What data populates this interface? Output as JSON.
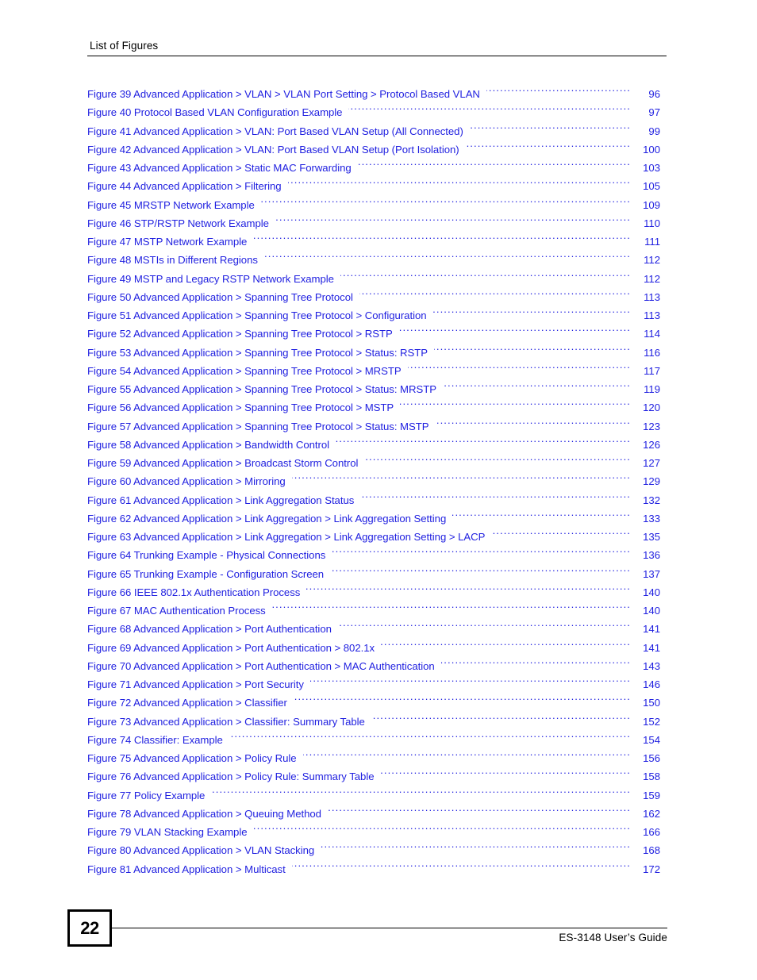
{
  "header": {
    "title": "List of Figures"
  },
  "figure_list": {
    "entries": [
      {
        "label": "Figure 39 Advanced Application > VLAN > VLAN Port Setting > Protocol Based VLAN",
        "page": "96"
      },
      {
        "label": "Figure 40 Protocol Based VLAN Configuration Example",
        "page": "97"
      },
      {
        "label": "Figure 41 Advanced Application > VLAN: Port Based VLAN Setup (All Connected)",
        "page": "99"
      },
      {
        "label": "Figure 42 Advanced Application > VLAN: Port Based VLAN Setup (Port Isolation)",
        "page": "100"
      },
      {
        "label": "Figure 43 Advanced Application > Static MAC Forwarding",
        "page": "103"
      },
      {
        "label": "Figure 44 Advanced Application > Filtering",
        "page": "105"
      },
      {
        "label": "Figure 45 MRSTP Network Example",
        "page": "109"
      },
      {
        "label": "Figure 46 STP/RSTP Network Example",
        "page": "110"
      },
      {
        "label": "Figure 47 MSTP Network Example",
        "page": "111"
      },
      {
        "label": "Figure 48 MSTIs in Different Regions",
        "page": "112"
      },
      {
        "label": "Figure 49 MSTP and Legacy RSTP Network Example",
        "page": "112"
      },
      {
        "label": "Figure 50 Advanced Application > Spanning Tree Protocol",
        "page": "113"
      },
      {
        "label": "Figure 51 Advanced Application > Spanning Tree Protocol > Configuration",
        "page": "113"
      },
      {
        "label": "Figure 52 Advanced Application > Spanning Tree Protocol > RSTP",
        "page": "114"
      },
      {
        "label": "Figure 53 Advanced Application > Spanning Tree Protocol > Status: RSTP",
        "page": "116"
      },
      {
        "label": "Figure 54 Advanced Application > Spanning Tree Protocol > MRSTP",
        "page": "117"
      },
      {
        "label": "Figure 55 Advanced Application > Spanning Tree Protocol > Status: MRSTP",
        "page": "119"
      },
      {
        "label": "Figure 56 Advanced Application > Spanning Tree Protocol > MSTP",
        "page": "120"
      },
      {
        "label": "Figure 57 Advanced Application > Spanning Tree Protocol > Status: MSTP",
        "page": "123"
      },
      {
        "label": "Figure 58 Advanced Application > Bandwidth Control",
        "page": "126"
      },
      {
        "label": "Figure 59 Advanced Application > Broadcast Storm Control",
        "page": "127"
      },
      {
        "label": "Figure 60 Advanced Application > Mirroring",
        "page": "129"
      },
      {
        "label": "Figure 61 Advanced Application > Link Aggregation Status",
        "page": "132"
      },
      {
        "label": "Figure 62 Advanced Application > Link Aggregation > Link Aggregation Setting",
        "page": "133"
      },
      {
        "label": "Figure 63 Advanced Application > Link Aggregation > Link Aggregation Setting > LACP",
        "page": "135"
      },
      {
        "label": "Figure 64 Trunking Example - Physical Connections",
        "page": "136"
      },
      {
        "label": "Figure 65 Trunking Example - Configuration Screen",
        "page": "137"
      },
      {
        "label": "Figure 66 IEEE 802.1x Authentication Process",
        "page": "140"
      },
      {
        "label": "Figure 67 MAC Authentication Process",
        "page": "140"
      },
      {
        "label": "Figure 68 Advanced Application > Port Authentication",
        "page": "141"
      },
      {
        "label": "Figure 69 Advanced Application > Port Authentication > 802.1x",
        "page": "141"
      },
      {
        "label": "Figure 70 Advanced Application > Port Authentication > MAC Authentication",
        "page": "143"
      },
      {
        "label": "Figure 71 Advanced Application > Port Security",
        "page": "146"
      },
      {
        "label": "Figure 72 Advanced Application > Classifier",
        "page": "150"
      },
      {
        "label": "Figure 73 Advanced Application > Classifier: Summary Table",
        "page": "152"
      },
      {
        "label": "Figure 74 Classifier: Example",
        "page": "154"
      },
      {
        "label": "Figure 75 Advanced Application > Policy Rule",
        "page": "156"
      },
      {
        "label": "Figure 76 Advanced Application > Policy Rule: Summary Table",
        "page": "158"
      },
      {
        "label": "Figure 77 Policy Example",
        "page": "159"
      },
      {
        "label": "Figure 78 Advanced Application > Queuing Method",
        "page": "162"
      },
      {
        "label": "Figure 79 VLAN Stacking Example",
        "page": "166"
      },
      {
        "label": "Figure 80 Advanced Application > VLAN Stacking",
        "page": "168"
      },
      {
        "label": "Figure 81 Advanced Application > Multicast",
        "page": "172"
      }
    ]
  },
  "footer": {
    "page_number": "22",
    "guide_title": "ES-3148 User’s Guide"
  },
  "colors": {
    "link_blue": "#1f1fe0",
    "text_black": "#000000",
    "page_background": "#ffffff"
  }
}
